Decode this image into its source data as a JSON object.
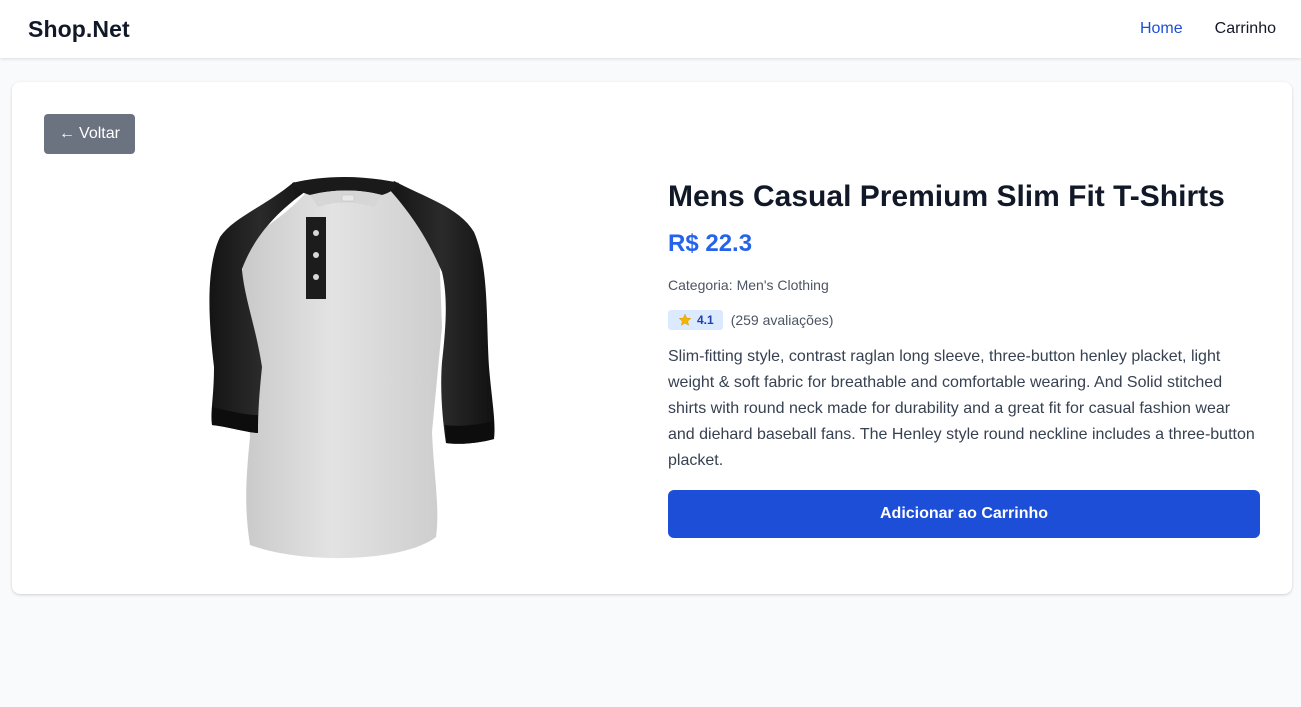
{
  "nav": {
    "brand": "Shop.Net",
    "home_label": "Home",
    "cart_label": "Carrinho"
  },
  "back_button": {
    "arrow": "←",
    "label": "Voltar"
  },
  "product": {
    "title": "Mens Casual Premium Slim Fit T-Shirts",
    "price": "R$ 22.3",
    "category_label": "Categoria:",
    "category": "Men's Clothing",
    "rating": "4.1",
    "reviews": "(259 avaliações)",
    "description": "Slim-fitting style, contrast raglan long sleeve, three-button henley placket, light weight & soft fabric for breathable and comfortable wearing. And Solid stitched shirts with round neck made for durability and a great fit for casual fashion wear and diehard baseball fans. The Henley style round neckline includes a three-button placket.",
    "add_to_cart_label": "Adicionar ao Carrinho",
    "image_icon": "raglan-henley-shirt"
  },
  "colors": {
    "accent": "#1d4ed8",
    "price": "#2563eb",
    "back_button": "#6b7280",
    "rating_badge_bg": "#dbeafe",
    "star": "#f5b400"
  }
}
